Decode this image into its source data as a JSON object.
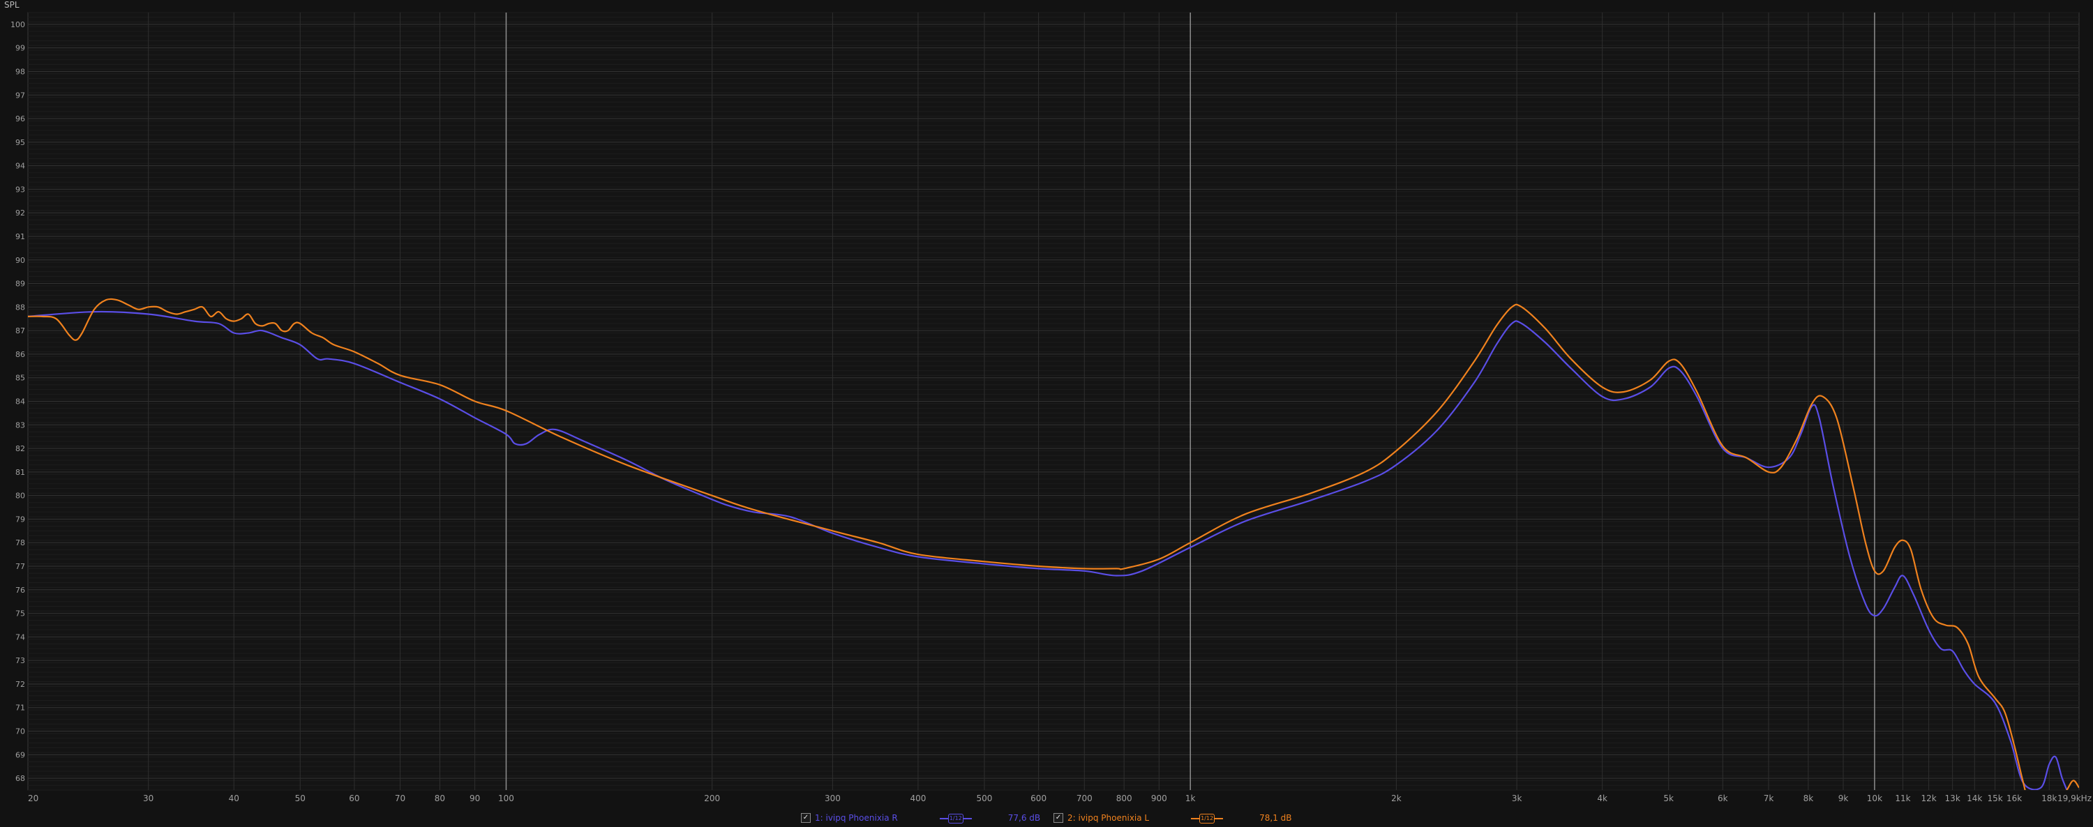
{
  "y_axis_title": "SPL",
  "colors": {
    "series1": "#5a4ee6",
    "series2": "#f0821e",
    "grid": "#2e2e2e",
    "major_grid": "#9a9a9a"
  },
  "legend": [
    {
      "check": "✓",
      "label": "1: ivipq Phoenixia R",
      "level": "77,6 dB",
      "smoothing": "1/12"
    },
    {
      "check": "✓",
      "label": "2: ivipq Phoenixia L",
      "level": "78,1 dB",
      "smoothing": "1/12"
    }
  ],
  "chart_data": {
    "type": "line",
    "x_scale": "log",
    "xlim": [
      20,
      19900
    ],
    "ylim": [
      67.5,
      100.5
    ],
    "x_ticks": [
      {
        "v": 20,
        "t": "20"
      },
      {
        "v": 30,
        "t": "30"
      },
      {
        "v": 40,
        "t": "40"
      },
      {
        "v": 50,
        "t": "50"
      },
      {
        "v": 60,
        "t": "60"
      },
      {
        "v": 70,
        "t": "70"
      },
      {
        "v": 80,
        "t": "80"
      },
      {
        "v": 90,
        "t": "90"
      },
      {
        "v": 100,
        "t": "100"
      },
      {
        "v": 200,
        "t": "200"
      },
      {
        "v": 300,
        "t": "300"
      },
      {
        "v": 400,
        "t": "400"
      },
      {
        "v": 500,
        "t": "500"
      },
      {
        "v": 600,
        "t": "600"
      },
      {
        "v": 700,
        "t": "700"
      },
      {
        "v": 800,
        "t": "800"
      },
      {
        "v": 900,
        "t": "900"
      },
      {
        "v": 1000,
        "t": "1k"
      },
      {
        "v": 2000,
        "t": "2k"
      },
      {
        "v": 3000,
        "t": "3k"
      },
      {
        "v": 4000,
        "t": "4k"
      },
      {
        "v": 5000,
        "t": "5k"
      },
      {
        "v": 6000,
        "t": "6k"
      },
      {
        "v": 7000,
        "t": "7k"
      },
      {
        "v": 8000,
        "t": "8k"
      },
      {
        "v": 9000,
        "t": "9k"
      },
      {
        "v": 10000,
        "t": "10k"
      },
      {
        "v": 11000,
        "t": "11k"
      },
      {
        "v": 12000,
        "t": "12k"
      },
      {
        "v": 13000,
        "t": "13k"
      },
      {
        "v": 14000,
        "t": "14k"
      },
      {
        "v": 15000,
        "t": "15k"
      },
      {
        "v": 16000,
        "t": "16k"
      },
      {
        "v": 18000,
        "t": "18k"
      },
      {
        "v": 19900,
        "t": "19,9kHz"
      }
    ],
    "x_major": [
      100,
      1000,
      10000
    ],
    "y_ticks": [
      68,
      69,
      70,
      71,
      72,
      73,
      74,
      75,
      76,
      77,
      78,
      79,
      80,
      81,
      82,
      83,
      84,
      85,
      86,
      87,
      88,
      89,
      90,
      91,
      92,
      93,
      94,
      95,
      96,
      97,
      98,
      99,
      100
    ],
    "series": [
      {
        "name": "1: ivipq Phoenixia R",
        "points": [
          [
            20,
            87.6
          ],
          [
            25,
            87.8
          ],
          [
            30,
            87.7
          ],
          [
            35,
            87.4
          ],
          [
            38,
            87.3
          ],
          [
            40,
            86.9
          ],
          [
            42,
            86.9
          ],
          [
            44,
            87.0
          ],
          [
            47,
            86.7
          ],
          [
            50,
            86.4
          ],
          [
            53,
            85.8
          ],
          [
            55,
            85.8
          ],
          [
            60,
            85.6
          ],
          [
            70,
            84.8
          ],
          [
            80,
            84.1
          ],
          [
            90,
            83.3
          ],
          [
            100,
            82.6
          ],
          [
            103,
            82.2
          ],
          [
            107,
            82.2
          ],
          [
            112,
            82.6
          ],
          [
            118,
            82.8
          ],
          [
            130,
            82.3
          ],
          [
            150,
            81.5
          ],
          [
            170,
            80.7
          ],
          [
            190,
            80.1
          ],
          [
            210,
            79.6
          ],
          [
            230,
            79.3
          ],
          [
            260,
            79.1
          ],
          [
            300,
            78.4
          ],
          [
            350,
            77.8
          ],
          [
            400,
            77.4
          ],
          [
            500,
            77.1
          ],
          [
            600,
            76.9
          ],
          [
            700,
            76.8
          ],
          [
            780,
            76.6
          ],
          [
            850,
            76.8
          ],
          [
            1000,
            77.8
          ],
          [
            1200,
            78.9
          ],
          [
            1500,
            79.8
          ],
          [
            1800,
            80.6
          ],
          [
            2000,
            81.3
          ],
          [
            2300,
            82.8
          ],
          [
            2600,
            84.8
          ],
          [
            2800,
            86.4
          ],
          [
            2950,
            87.3
          ],
          [
            3050,
            87.3
          ],
          [
            3300,
            86.5
          ],
          [
            3600,
            85.4
          ],
          [
            4000,
            84.2
          ],
          [
            4300,
            84.1
          ],
          [
            4700,
            84.6
          ],
          [
            5000,
            85.4
          ],
          [
            5200,
            85.3
          ],
          [
            5500,
            84.2
          ],
          [
            6000,
            82.0
          ],
          [
            6500,
            81.6
          ],
          [
            7000,
            81.2
          ],
          [
            7500,
            81.6
          ],
          [
            7800,
            82.6
          ],
          [
            8100,
            83.8
          ],
          [
            8300,
            83.3
          ],
          [
            8700,
            80.4
          ],
          [
            9200,
            77.4
          ],
          [
            9700,
            75.4
          ],
          [
            10000,
            74.9
          ],
          [
            10300,
            75.2
          ],
          [
            10700,
            76.1
          ],
          [
            11000,
            76.6
          ],
          [
            11400,
            75.8
          ],
          [
            12000,
            74.3
          ],
          [
            12500,
            73.5
          ],
          [
            13000,
            73.4
          ],
          [
            13500,
            72.6
          ],
          [
            14000,
            72.0
          ],
          [
            15000,
            71.2
          ],
          [
            15800,
            69.6
          ],
          [
            16500,
            67.8
          ],
          [
            17500,
            67.6
          ],
          [
            18000,
            68.6
          ],
          [
            18400,
            68.9
          ],
          [
            18800,
            68.0
          ],
          [
            19300,
            67.2
          ]
        ]
      },
      {
        "name": "2: ivipq Phoenixia L",
        "points": [
          [
            20,
            87.6
          ],
          [
            21,
            87.6
          ],
          [
            22,
            87.5
          ],
          [
            23,
            86.8
          ],
          [
            23.5,
            86.6
          ],
          [
            24,
            86.9
          ],
          [
            25,
            87.9
          ],
          [
            26,
            88.3
          ],
          [
            27,
            88.3
          ],
          [
            28,
            88.1
          ],
          [
            29,
            87.9
          ],
          [
            30,
            88.0
          ],
          [
            31,
            88.0
          ],
          [
            32,
            87.8
          ],
          [
            33,
            87.7
          ],
          [
            34,
            87.8
          ],
          [
            35,
            87.9
          ],
          [
            36,
            88.0
          ],
          [
            37,
            87.6
          ],
          [
            38,
            87.8
          ],
          [
            39,
            87.5
          ],
          [
            40,
            87.4
          ],
          [
            41,
            87.5
          ],
          [
            42,
            87.7
          ],
          [
            43,
            87.3
          ],
          [
            44,
            87.2
          ],
          [
            45,
            87.3
          ],
          [
            46,
            87.3
          ],
          [
            47,
            87.0
          ],
          [
            48,
            87.0
          ],
          [
            49,
            87.3
          ],
          [
            50,
            87.3
          ],
          [
            52,
            86.9
          ],
          [
            54,
            86.7
          ],
          [
            56,
            86.4
          ],
          [
            60,
            86.1
          ],
          [
            65,
            85.6
          ],
          [
            70,
            85.1
          ],
          [
            80,
            84.7
          ],
          [
            90,
            84.0
          ],
          [
            100,
            83.6
          ],
          [
            120,
            82.5
          ],
          [
            150,
            81.3
          ],
          [
            200,
            80.0
          ],
          [
            230,
            79.4
          ],
          [
            300,
            78.5
          ],
          [
            350,
            78.0
          ],
          [
            400,
            77.5
          ],
          [
            500,
            77.2
          ],
          [
            600,
            77.0
          ],
          [
            700,
            76.9
          ],
          [
            780,
            76.9
          ],
          [
            800,
            76.9
          ],
          [
            900,
            77.3
          ],
          [
            1000,
            78.0
          ],
          [
            1200,
            79.2
          ],
          [
            1500,
            80.1
          ],
          [
            1800,
            81.0
          ],
          [
            2000,
            81.9
          ],
          [
            2300,
            83.6
          ],
          [
            2600,
            85.7
          ],
          [
            2800,
            87.2
          ],
          [
            2950,
            88.0
          ],
          [
            3050,
            88.0
          ],
          [
            3300,
            87.1
          ],
          [
            3600,
            85.8
          ],
          [
            4000,
            84.6
          ],
          [
            4300,
            84.4
          ],
          [
            4700,
            84.9
          ],
          [
            5000,
            85.7
          ],
          [
            5200,
            85.6
          ],
          [
            5500,
            84.4
          ],
          [
            6000,
            82.1
          ],
          [
            6500,
            81.6
          ],
          [
            7000,
            81.0
          ],
          [
            7300,
            81.2
          ],
          [
            7700,
            82.4
          ],
          [
            8100,
            83.9
          ],
          [
            8400,
            84.2
          ],
          [
            8800,
            83.3
          ],
          [
            9300,
            80.4
          ],
          [
            9700,
            78.0
          ],
          [
            10000,
            76.8
          ],
          [
            10300,
            76.8
          ],
          [
            10700,
            77.8
          ],
          [
            11000,
            78.1
          ],
          [
            11300,
            77.7
          ],
          [
            11700,
            76.0
          ],
          [
            12200,
            74.8
          ],
          [
            12700,
            74.5
          ],
          [
            13200,
            74.4
          ],
          [
            13700,
            73.7
          ],
          [
            14200,
            72.3
          ],
          [
            15000,
            71.4
          ],
          [
            15500,
            70.8
          ],
          [
            16000,
            69.4
          ],
          [
            16500,
            67.8
          ],
          [
            17000,
            66.5
          ],
          [
            18000,
            66.5
          ],
          [
            19000,
            67.4
          ],
          [
            19500,
            67.9
          ],
          [
            19900,
            67.6
          ]
        ]
      }
    ]
  }
}
